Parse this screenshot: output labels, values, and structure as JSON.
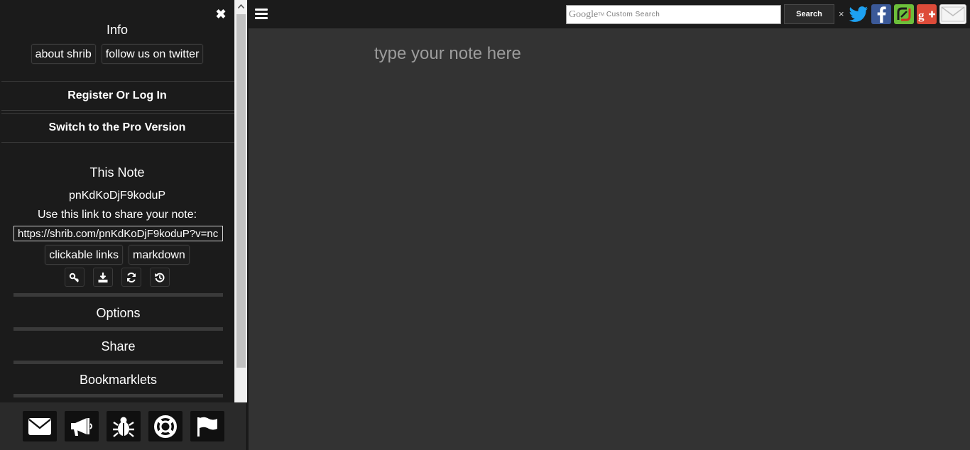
{
  "sidebar": {
    "info_title": "Info",
    "about_label": "about shrib",
    "twitter_label": "follow us on twitter",
    "register_label": "Register Or Log In",
    "pro_label": "Switch to the Pro Version",
    "note_title": "This Note",
    "note_id": "pnKdKoDjF9koduP",
    "share_text": "Use this link to share your note:",
    "share_link": "https://shrib.com/pnKdKoDjF9koduP?v=nc",
    "clickable_links_label": "clickable links",
    "markdown_label": "markdown",
    "action_icons": [
      "key-icon",
      "download-icon",
      "refresh-icon",
      "history-icon"
    ],
    "options_label": "Options",
    "share_label": "Share",
    "bookmarklets_label": "Bookmarklets",
    "dock_icons": [
      "envelope-icon",
      "megaphone-icon",
      "bug-icon",
      "lifebuoy-icon",
      "flag-icon"
    ]
  },
  "topbar": {
    "google_text": "Google",
    "google_tm": "TM",
    "custom_search_text": "Custom Search",
    "search_label": "Search",
    "clear_label": "×",
    "social_icons": [
      "twitter-icon",
      "facebook-icon",
      "shrib-share-icon",
      "google-plus-icon",
      "mail-icon"
    ]
  },
  "note": {
    "placeholder": "type your note here"
  },
  "colors": {
    "sidebar_bg": "#1b1b1b",
    "editor_bg": "#333333",
    "twitter": "#1da1f2",
    "facebook": "#3b5998",
    "shrib_green": "#6cbf3a",
    "google_plus": "#dd4b39"
  }
}
